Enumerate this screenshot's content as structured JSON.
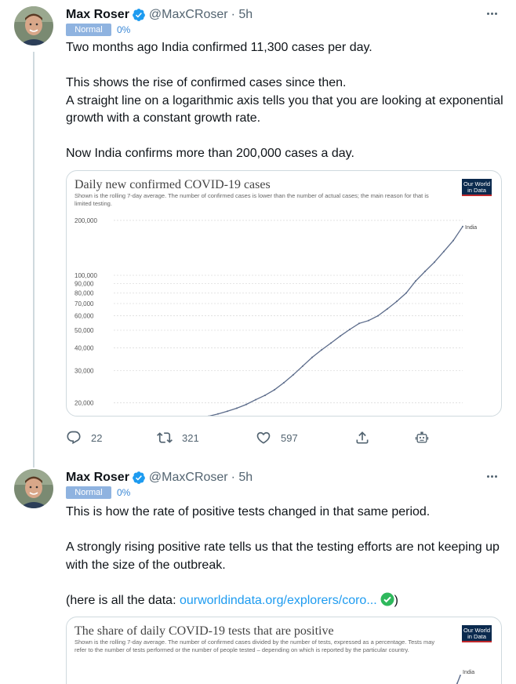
{
  "tweets": [
    {
      "author": "Max Roser",
      "handle": "@MaxCRoser",
      "time": "· 5h",
      "badge": "Normal",
      "percent": "0%",
      "text_lines": [
        "Two months ago India confirmed 11,300 cases per day.",
        "",
        "This shows the rise of confirmed cases since then.",
        "A straight line on a logarithmic axis tells you that you are looking at exponential growth with a constant growth rate.",
        "",
        "Now India confirms more than 200,000 cases a day."
      ],
      "card": {
        "title": "Daily new confirmed COVID-19 cases",
        "subtitle": "Shown is the rolling 7-day average. The number of confirmed cases is lower than the number of actual cases; the main reason for that is limited testing.",
        "logo": "Our World in Data"
      },
      "actions": {
        "reply": "22",
        "retweet": "321",
        "like": "597"
      }
    },
    {
      "author": "Max Roser",
      "handle": "@MaxCRoser",
      "time": "· 5h",
      "badge": "Normal",
      "percent": "0%",
      "text_lines": [
        "This is how the rate of positive tests changed in that same period.",
        "",
        "A strongly rising positive rate tells us that the testing efforts are not keeping up with the size of the outbreak.",
        ""
      ],
      "link_prefix": "(here is all the data: ",
      "link_text": "ourworldindata.org/explorers/coro...",
      "link_suffix": ")",
      "card": {
        "title": "The share of daily COVID-19 tests that are positive",
        "subtitle": "Shown is the rolling 7-day average. The number of confirmed cases divided by the number of tests, expressed as a percentage. Tests may refer to the number of tests performed or the number of people tested – depending on which is reported by the particular country.",
        "logo": "Our World in Data",
        "series_label": "India"
      }
    }
  ],
  "chart_data": [
    {
      "type": "line",
      "title": "Daily new confirmed COVID-19 cases",
      "scale": "log",
      "yticks": [
        "20,000",
        "30,000",
        "40,000",
        "50,000",
        "60,000",
        "70,000",
        "80,000",
        "90,000",
        "100,000",
        "200,000"
      ],
      "ylim": [
        17000,
        210000
      ],
      "series": [
        {
          "name": "India",
          "x": [
            0,
            2,
            4,
            6,
            8,
            10,
            12,
            14,
            16,
            18,
            20,
            22,
            24,
            26,
            28,
            30,
            32,
            34,
            36,
            38,
            40,
            42,
            44,
            46,
            48,
            50,
            52,
            54,
            56,
            58,
            60
          ],
          "values": [
            16500,
            16500,
            16600,
            16900,
            17400,
            18000,
            18700,
            19600,
            20800,
            22000,
            23600,
            25800,
            28500,
            31800,
            35500,
            39000,
            42500,
            46500,
            50500,
            54500,
            56500,
            60000,
            65500,
            72000,
            80000,
            93000,
            105000,
            118000,
            135000,
            155000,
            185000
          ]
        }
      ]
    }
  ]
}
